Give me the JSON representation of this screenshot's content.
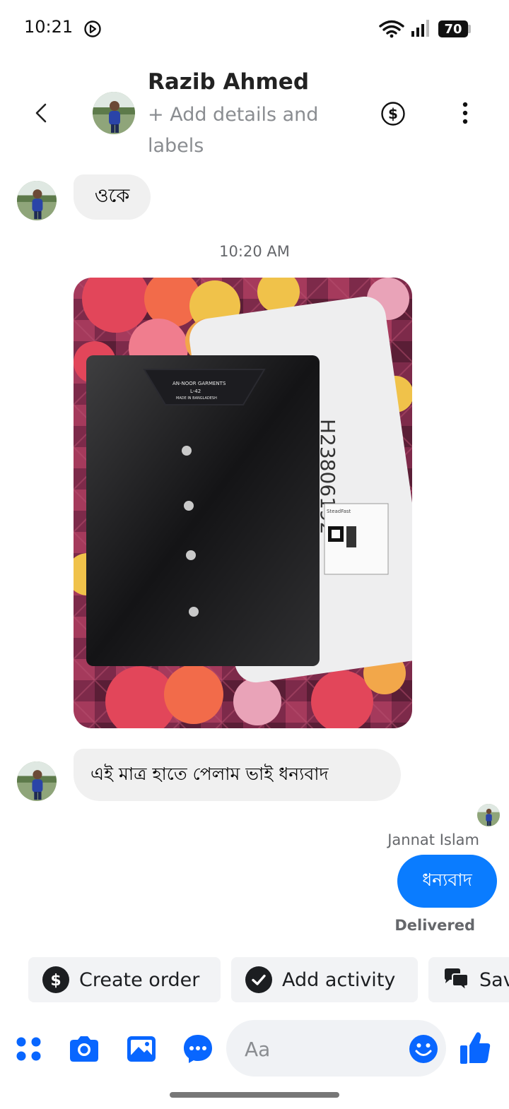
{
  "status_bar": {
    "time": "10:21",
    "battery": "70"
  },
  "header": {
    "contact_name": "Razib Ahmed",
    "add_details": "+ Add details and labels"
  },
  "messages": {
    "first": "ওকে",
    "timestamp": "10:20 AM",
    "second": "এই মাত্র হাতে পেলাম ভাই ধন্যবাদ",
    "reply_sender": "Jannat Islam",
    "reply": "ধন্যবাদ",
    "reply_status": "Delivered"
  },
  "photo": {
    "label_brand": "AN-NOOR GARMENTS",
    "label_size": "L-42",
    "label_origin": "MADE IN BANGLADESH",
    "handwritten_code": "H23806192",
    "shipping_label_brand": "SteadFast"
  },
  "quick_actions": [
    {
      "label": "Create order",
      "icon": "dollar-circle-icon"
    },
    {
      "label": "Add activity",
      "icon": "check-circle-icon"
    },
    {
      "label": "Saved replies",
      "icon": "chat-bubbles-icon"
    }
  ],
  "composer": {
    "placeholder": "Aa"
  },
  "colors": {
    "accent": "#0a7cff",
    "icon_blue": "#0866ff",
    "bubble_in": "#f0f0f0",
    "chip_bg": "#f2f3f5"
  }
}
